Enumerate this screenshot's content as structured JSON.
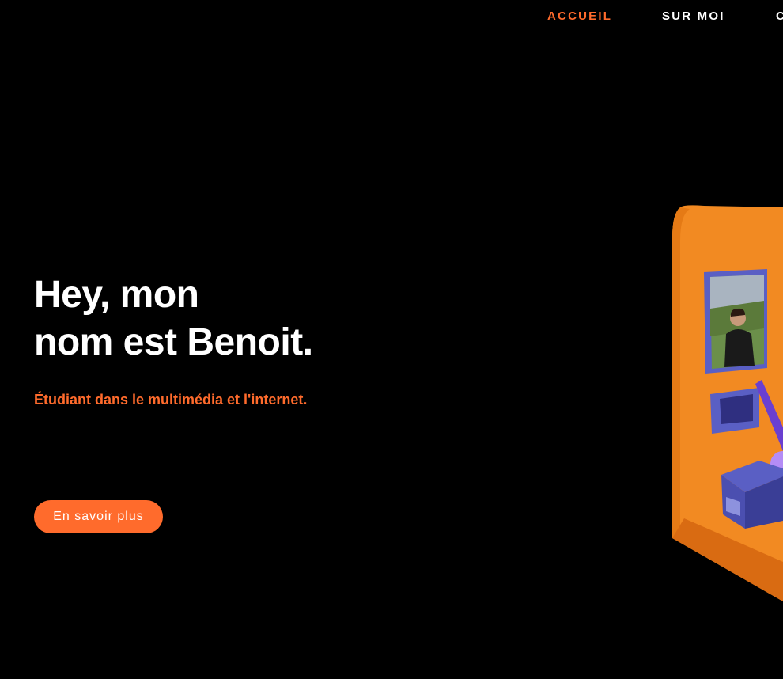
{
  "nav": {
    "items": [
      {
        "label": "ACCUEIL",
        "active": true
      },
      {
        "label": "SUR MOI",
        "active": false
      },
      {
        "label": "C",
        "active": false
      }
    ]
  },
  "hero": {
    "title_line1": "Hey, mon",
    "title_line2": "nom est Benoit.",
    "subtitle": "Étudiant dans le multimédia et l'internet.",
    "cta_label": "En savoir plus"
  },
  "colors": {
    "background": "#000000",
    "accent": "#ff6b2c",
    "text": "#ffffff",
    "illustration_orange": "#f28a22",
    "illustration_blue": "#4b4fb0",
    "illustration_purple": "#9b6cf0"
  },
  "illustration": {
    "name": "3d-room-illustration",
    "elements": [
      "portrait-frame",
      "small-frame",
      "box",
      "guitar"
    ]
  }
}
